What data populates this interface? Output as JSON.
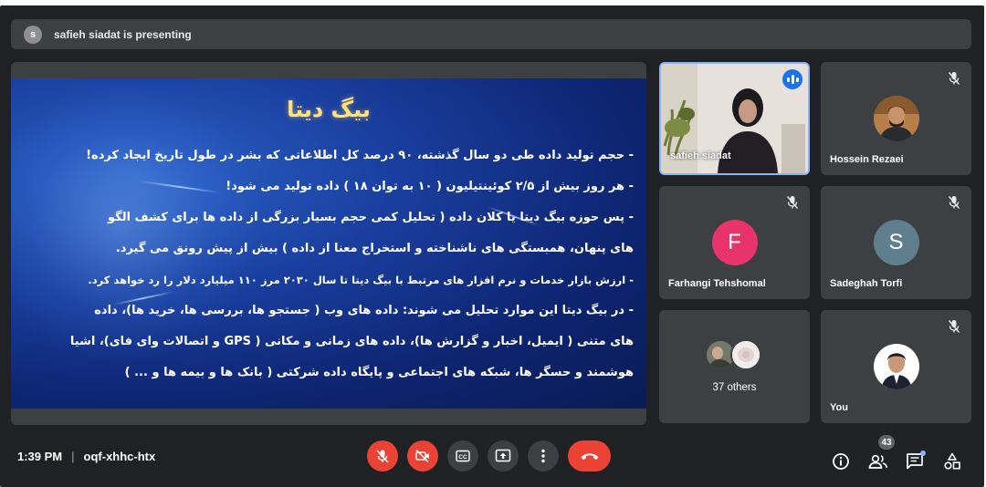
{
  "banner": {
    "avatar_letter": "s",
    "text": "safieh siadat is presenting"
  },
  "slide": {
    "title": "بیگ دیتا",
    "bullets": [
      "-   حجم تولید داده طی دو سال گذشته، ۹۰ درصد کل اطلاعاتی که بشر در طول تاریخ ایجاد کرده!",
      "-   هر روز بیش از ۲/۵ کوئینتیلیون ( ۱۰ به توان ۱۸ ) داده تولید می شود!",
      "-   پس حوزه بیگ دیتا یا کلان داده ( تحلیل کمی حجم بسیار بزرگی از داده ها برای کشف الگو",
      "های پنهان، همبستگی های ناشناخته و استخراج معنا از داده ) بیش از پیش رونق می گیرد.",
      "-   ارزش بازار خدمات و نرم افزار های مرتبط با بیگ دیتا تا سال ۲۰۳۰ مرز ۱۱۰ میلیارد دلار را رد خواهد کرد.",
      "-   در بیگ دیتا این موارد تحلیل می شوند: داده های وب ( جستجو ها، بررسی ها، خرید ها)، داده",
      "های متنی ( ایمیل، اخبار و گزارش ها)، داده های زمانی و مکانی ( GPS و اتصالات وای فای)، اشیا",
      "هوشمند و حسگر ها، شبکه های اجتماعی و پایگاه داده شرکتی ( بانک ها و بیمه ها و ... )"
    ]
  },
  "participants": {
    "speaker": {
      "name": "safieh siadat"
    },
    "hossein": {
      "name": "Hossein Rezaei"
    },
    "farhangi": {
      "name": "Farhangi Tehshomal",
      "letter": "F",
      "color": "#e8336d"
    },
    "sadeghah": {
      "name": "Sadeghah Torfi",
      "letter": "S",
      "color": "#5f7f8f"
    },
    "others": {
      "label": "37 others"
    },
    "you": {
      "name": "You"
    }
  },
  "bottom": {
    "time": "1:39 PM",
    "separator": "|",
    "meeting_code": "oqf-xhhc-htx",
    "people_count": "43"
  },
  "colors": {
    "background": "#202124",
    "tile": "#3c4043",
    "danger": "#ea4335",
    "accent": "#8ab4f8"
  },
  "icons": {
    "controls": [
      "mic-off-icon",
      "camera-off-icon",
      "captions-icon",
      "present-icon",
      "more-icon",
      "hang-up-icon"
    ],
    "right": [
      "info-icon",
      "people-icon",
      "chat-icon",
      "activities-icon"
    ]
  }
}
